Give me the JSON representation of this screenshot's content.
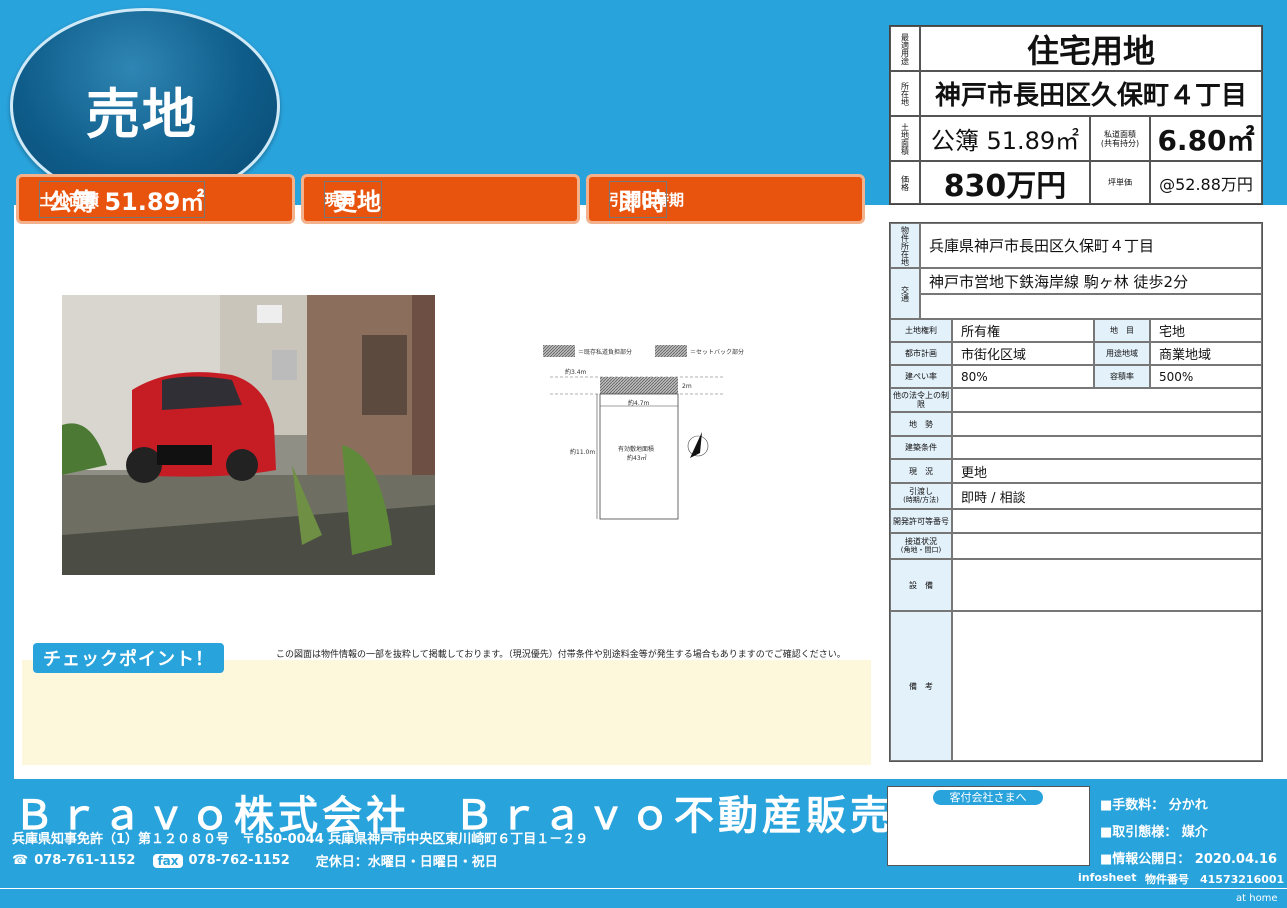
{
  "header": {
    "badge": "売地",
    "bars": [
      {
        "label": "土地面積",
        "value": "公簿 51.89㎡"
      },
      {
        "label": "現況",
        "value": "更地"
      },
      {
        "label": "引渡し時期",
        "value": "即時"
      }
    ]
  },
  "summary": {
    "usage_label": "最適用途",
    "usage": "住宅用地",
    "location_label": "所在地",
    "location": "神戸市長田区久保町４丁目",
    "area_label": "土地面積",
    "area": "公簿 51.89㎡",
    "private_road_label_1": "私道面積",
    "private_road_label_2": "(共有持分)",
    "private_road": "6.80㎡",
    "price_label": "価格",
    "price": "830万円",
    "tsubo_label": "坪単価",
    "tsubo": "@52.88万円"
  },
  "details": {
    "address_label": "物件所在地",
    "address": "兵庫県神戸市長田区久保町４丁目",
    "transport_label": "交通",
    "transport": "神戸市営地下鉄海岸線 駒ヶ林 徒歩2分",
    "rights_label": "土地権利",
    "rights": "所有権",
    "landcat_label": "地　目",
    "landcat": "宅地",
    "urban_label": "都市計画",
    "urban": "市街化区域",
    "zoning_label": "用途地域",
    "zoning": "商業地域",
    "bcr_label": "建ぺい率",
    "bcr": "80%",
    "far_label": "容積率",
    "far": "500%",
    "other_label": "他の法令上の制限",
    "terrain_label": "地　勢",
    "build_label": "建築条件",
    "status_label": "現　況",
    "status": "更地",
    "handover_label_1": "引渡し",
    "handover_label_2": "(時期/方法)",
    "handover": "即時 / 相談",
    "dev_label": "開発許可等番号",
    "road_label_1": "接道状況",
    "road_label_2": "(角地・間口)",
    "equip_label": "設　備",
    "remarks_label": "備　考"
  },
  "diagram": {
    "legend_1": "＝既存私道負担部分",
    "legend_2": "＝セットバック部分",
    "dim_road": "約3.4m",
    "dim_setback": "2m",
    "dim_width": "約4.7m",
    "dim_depth": "約11.0m",
    "area_label": "有効敷地面積",
    "area_value": "約43㎡"
  },
  "check": {
    "title": "チェックポイント！",
    "disclaimer": "この図面は物件情報の一部を抜粋して掲載しております。（現況優先）付帯条件や別途料金等が発生する場合もありますのでご確認ください。"
  },
  "footer": {
    "company": "Ｂｒａｖｏ株式会社　Ｂｒａｖｏ不動産販売",
    "license": "兵庫県知事免許（1）第１２０８０号　〒650-0044 兵庫県神戸市中央区東川崎町６丁目１－２９",
    "tel": "078-761-1152",
    "fax_badge": "fax",
    "fax": "078-762-1152",
    "holiday": "定休日：水曜日・日曜日・祝日",
    "kyotaku": "客付会社さまへ",
    "fee": "■手数料：  分かれ",
    "deal": "■取引態様：  媒介",
    "published": "■情報公開日：  2020.04.16",
    "infosheet": "infosheet",
    "bukken_no": "物件番号　41573216001",
    "athome": "at home"
  }
}
